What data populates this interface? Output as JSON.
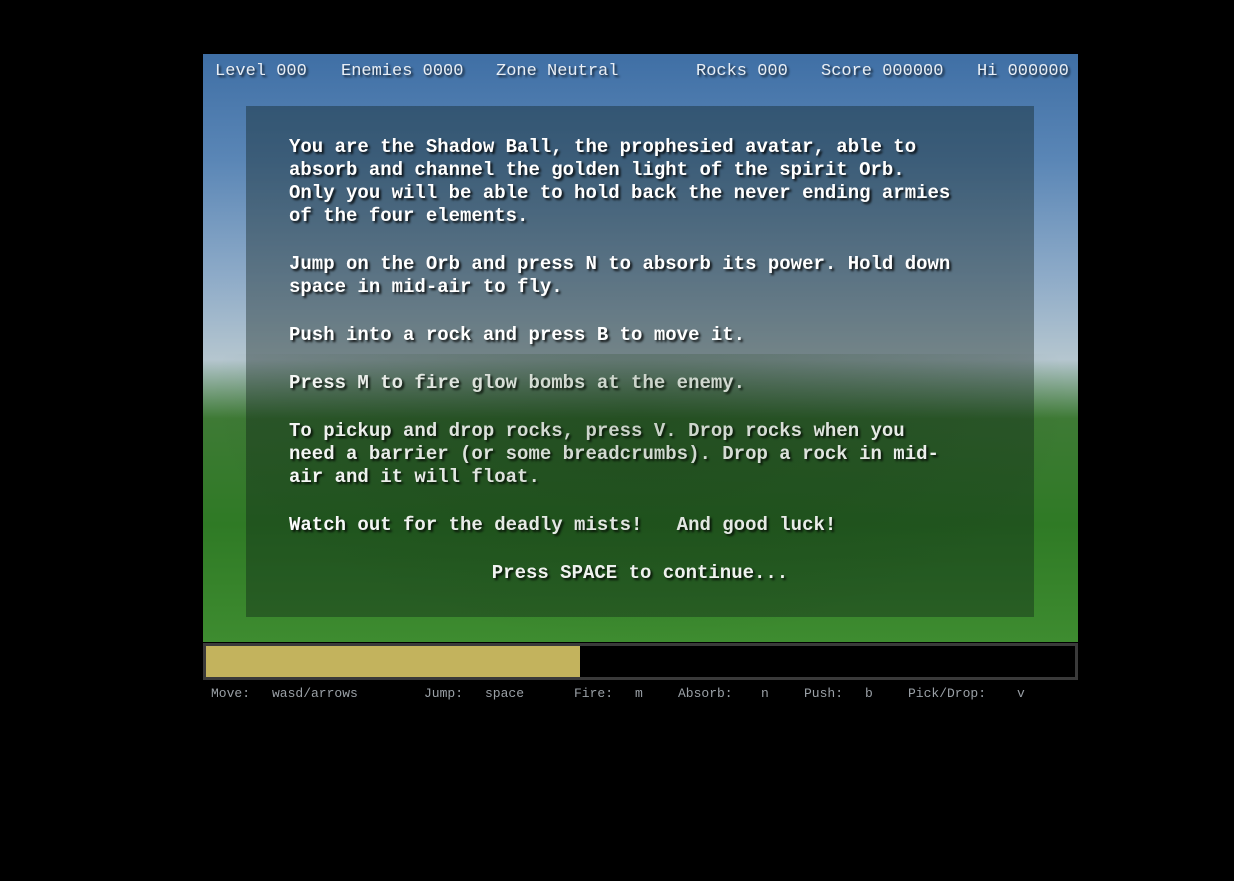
{
  "hud": {
    "level": "Level 000",
    "enemies": "Enemies 0000",
    "zone": "Zone Neutral",
    "rocks": "Rocks 000",
    "score": "Score 000000",
    "hi": "Hi 000000"
  },
  "intro": {
    "paragraphs": [
      "You are the Shadow Ball, the prophesied avatar, able to\nabsorb and channel the golden light of the spirit Orb.\nOnly you will be able to hold back the never ending armies\nof the four elements.",
      "Jump on the Orb and press N to absorb its power. Hold down\nspace in mid-air to fly.",
      "Push into a rock and press B to move it.",
      "Press M to fire glow bombs at the enemy.",
      "To pickup and drop rocks, press V. Drop rocks when you\nneed a barrier (or some breadcrumbs). Drop a rock in mid-\nair and it will float.",
      "Watch out for the deadly mists!   And good luck!"
    ],
    "continue": "Press SPACE to continue..."
  },
  "power_bar": {
    "fill_fraction": 0.43,
    "fill_color": "#c3b35d"
  },
  "controls": {
    "move_label": "Move:",
    "move_key": "wasd/arrows",
    "jump_label": "Jump:",
    "jump_key": "space",
    "fire_label": "Fire:",
    "fire_key": "m",
    "absorb_label": "Absorb:",
    "absorb_key": "n",
    "push_label": "Push:",
    "push_key": "b",
    "pick_label": "Pick/Drop:",
    "pick_key": "v"
  }
}
